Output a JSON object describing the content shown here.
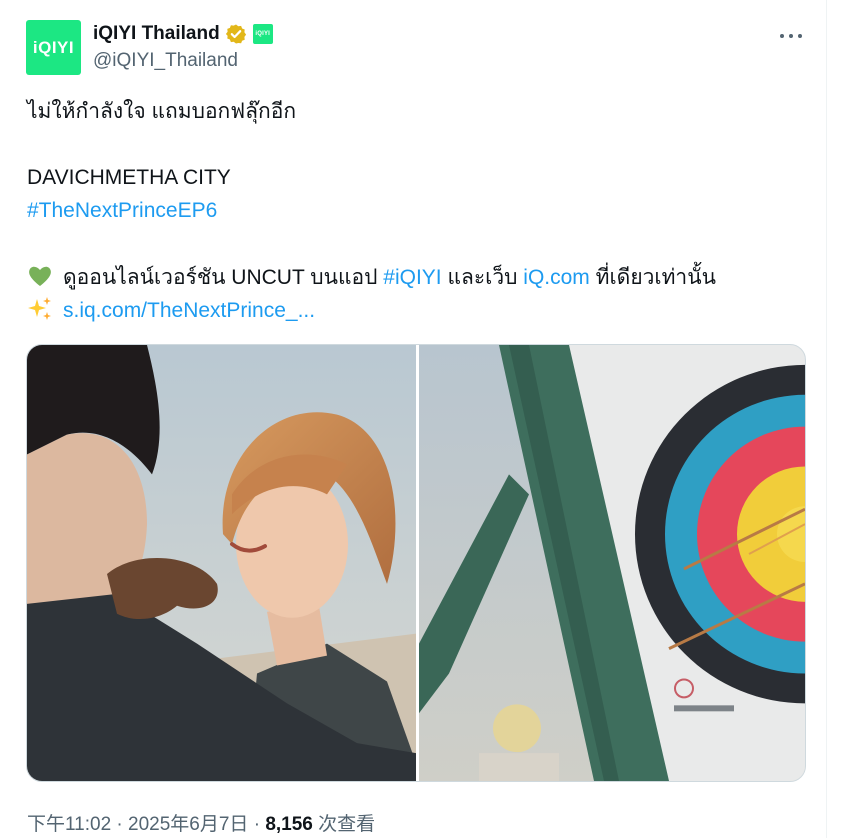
{
  "account": {
    "avatar_text": "iQIYI",
    "display_name": "iQIYI Thailand",
    "handle": "@iQIYI_Thailand",
    "affiliate_badge_text": "iQIYI"
  },
  "post": {
    "line1": "ไม่ให้กำลังใจ แถมบอกฟลุ๊กอีก",
    "line2": "DAVICHMETHA CITY",
    "hashtag": "#TheNextPrinceEP6",
    "line4_prefix": "ดูออนไลน์เวอร์ชัน UNCUT บนแอป",
    "line4_hashtag": "#iQIYI",
    "line4_mid": "และเว็บ",
    "line4_link": "iQ.com",
    "line4_suffix": "ที่เดียวเท่านั้น",
    "short_link": "s.iq.com/TheNextPrince_..."
  },
  "meta": {
    "time": "下午11:02",
    "separator1": "·",
    "date": "2025年6月7日",
    "separator2": "·",
    "views_count": "8,156",
    "views_label": "次查看"
  },
  "icons": {
    "verified": "verified-badge-icon",
    "more": "more-icon",
    "heart": "green-heart-icon",
    "sparkle": "sparkles-icon"
  },
  "colors": {
    "brand_green": "#1ce783",
    "link_blue": "#1d9bf0",
    "text": "#0f1419",
    "muted": "#536471",
    "verified_gold": "#e2b719"
  }
}
